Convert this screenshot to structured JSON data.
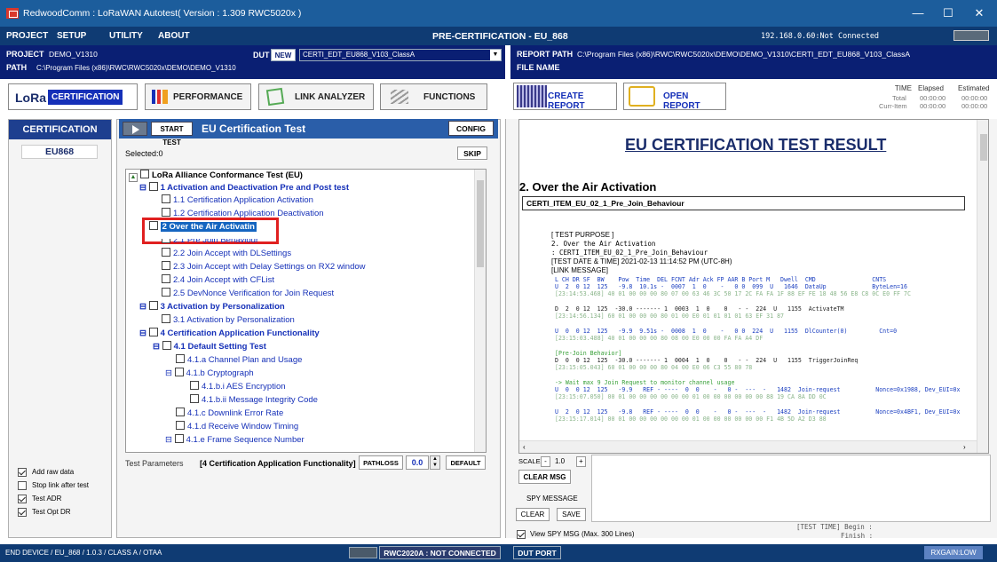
{
  "window": {
    "title": "RedwoodComm : LoRaWAN Autotest( Version : 1.309 RWC5020x )",
    "minimize": "—",
    "maximize": "☐",
    "close": "✕"
  },
  "menu": {
    "items": [
      "PROJECT",
      "SETUP",
      "UTILITY",
      "ABOUT"
    ],
    "center_title": "PRE-CERTIFICATION - EU_868",
    "ip_status": "192.168.0.60:Not Connected"
  },
  "project": {
    "project_label": "PROJECT",
    "project_value": "DEMO_V1310",
    "path_label": "PATH",
    "path_value": "C:\\Program Files (x86)\\RWC\\RWC5020x\\DEMO\\DEMO_V1310",
    "dut_label": "DUT",
    "new_label": "NEW",
    "dut_value": "CERTI_EDT_EU868_V103_ClassA"
  },
  "report": {
    "path_label": "REPORT PATH",
    "path_value": "C:\\Program Files (x86)\\RWC\\RWC5020x\\DEMO\\DEMO_V1310\\CERTI_EDT_EU868_V103_ClassA",
    "file_label": "FILE NAME"
  },
  "toolbar": {
    "lora": "LoRa",
    "certification": "CERTIFICATION",
    "performance": "PERFORMANCE",
    "link_analyzer": "LINK ANALYZER",
    "functions": "FUNCTIONS",
    "create_report": "CREATE REPORT",
    "open_report": "OPEN REPORT"
  },
  "timing": {
    "time": "TIME",
    "elapsed": "Elapsed",
    "estimated": "Estimated",
    "total": "Total",
    "curr_item": "Curr-Item",
    "total_elapsed": "00:00:00",
    "total_estimated": "00:00:00",
    "curr_elapsed": "00:00:00",
    "curr_estimated": "00:00:00"
  },
  "left": {
    "header": "CERTIFICATION",
    "region": "EU868",
    "options": [
      {
        "label": "Add raw data",
        "checked": true
      },
      {
        "label": "Stop link after test",
        "checked": false
      },
      {
        "label": "Test ADR",
        "checked": true
      },
      {
        "label": "Test Opt DR",
        "checked": true
      }
    ]
  },
  "center": {
    "start_test": "START TEST",
    "title": "EU Certification Test",
    "config": "CONFIG",
    "selected": "Selected:0",
    "skip": "SKIP",
    "tree": [
      {
        "label": "LoRa Alliance Conformance Test (EU)",
        "style": "root"
      },
      {
        "label": "1 Activation and Deactivation Pre and Post test",
        "style": "blue"
      },
      {
        "label": "1.1 Certification Application Activation",
        "style": "lnk"
      },
      {
        "label": "1.2 Certification Application Deactivation",
        "style": "lnk"
      },
      {
        "label": "2 Over the Air Activatin",
        "style": "sel"
      },
      {
        "label": "2.1 Pre Join Behaviour",
        "style": "lnk"
      },
      {
        "label": "2.2 Join Accept with DLSettings",
        "style": "lnk"
      },
      {
        "label": "2.3 Join Accept with Delay Settings on RX2 window",
        "style": "lnk"
      },
      {
        "label": "2.4 Join Accept with CFList",
        "style": "lnk"
      },
      {
        "label": "2.5 DevNonce Verification for Join Request",
        "style": "lnk"
      },
      {
        "label": "3 Activation by Personalization",
        "style": "blue"
      },
      {
        "label": "3.1 Activation by Personalization",
        "style": "lnk"
      },
      {
        "label": "4 Certification Application Functionality",
        "style": "blue"
      },
      {
        "label": "4.1 Default Setting Test",
        "style": "blue"
      },
      {
        "label": "4.1.a Channel Plan and Usage",
        "style": "lnk"
      },
      {
        "label": "4.1.b Cryptograph",
        "style": "lnk"
      },
      {
        "label": "4.1.b.i AES Encryption",
        "style": "lnk"
      },
      {
        "label": "4.1.b.ii Message Integrity Code",
        "style": "lnk"
      },
      {
        "label": "4.1.c Downlink Error Rate",
        "style": "lnk"
      },
      {
        "label": "4.1.d Receive Window Timing",
        "style": "lnk"
      },
      {
        "label": "4.1.e Frame Sequence Number",
        "style": "lnk"
      }
    ],
    "test_params_label": "Test Parameters",
    "test_params_value": "[4 Certification Application Functionality]",
    "pathloss": "PATHLOSS",
    "pathloss_value": "0.0",
    "default": "DEFAULT"
  },
  "right": {
    "heading": "EU CERTIFICATION TEST RESULT",
    "section": "2. Over the Air Activation",
    "item": "CERTI_ITEM_EU_02_1_Pre_Join_Behaviour",
    "purpose_lines": [
      "[ TEST PURPOSE ]",
      "2. Over the Air Activation",
      " : CERTI_ITEM_EU_02_1_Pre_Join_Behaviour",
      "[TEST DATE & TIME] 2021-02-13 11:14:52 PM (UTC-8H)",
      "[LINK MESSAGE]"
    ],
    "log_header": " L CH DR SF  BW    Pow  Time  DEL FCNT Adr Ack FP AAR B Port M   Dwell  CMD                CNTS",
    "log_rows": [
      {
        "main": " U  2  0 12  125   -9.8  10.1s -  0007  1  0    -   0 0  099  U   1646  DataUp             ByteLen=16",
        "raw": " [23:14:53.468] 40 01 00 00 00 80 07 00 63 46 3C 50 17 2C FA FA 1F 88 EF FE 18 48 56 E8 C8 0C E0 FF 7C",
        "cls": "b"
      },
      {
        "main": " D  2  0 12  125  -30.0 ------- 1  0003  1  0    0   - -  224  U   1155  ActivateTM",
        "raw": " [23:14:56.134] 60 01 00 00 00 80 01 00 E0 01 01 01 01 63 EF 31 87",
        "cls": "k"
      },
      {
        "main": " U  0  0 12  125   -9.9  9.51s -  0008  1  0    -   0 0  224  U   1155  DlCounter(0)         Cnt=0",
        "raw": " [23:15:03.488] 40 01 00 00 00 80 08 00 E0 00 00 FA FA A4 DF",
        "cls": "b"
      },
      {
        "main": " [Pre-Join Behavior]",
        "raw": "",
        "cls": "g"
      },
      {
        "main": " D  0  0 12  125  -30.0 ------- 1  0004  1  0    0   - -  224  U   1155  TriggerJoinReq",
        "raw": " [23:15:05.043] 60 01 00 00 00 80 04 00 E0 06 C3 55 80 78",
        "cls": "k"
      },
      {
        "main": " -> Wait max 9 Join Request to monitor channel usage",
        "raw": "",
        "cls": "g"
      },
      {
        "main": " U  0  0 12  125   -9.9   REF - ----  0  0    -   0 -  ---  -   1482  Join-request          Nonce=0x1988, Dev_EUI=0x",
        "raw": " [23:15:07.050] 00 01 00 00 00 00 00 00 01 00 00 00 00 00 00 88 19 CA 8A DD 0C",
        "cls": "b"
      },
      {
        "main": " U  2  0 12  125   -9.8   REF - ----  0  0    -   0 -  ---  -   1482  Join-request          Nonce=0x4BF1, Dev_EUI=0x",
        "raw": " [23:15:17.014] 00 01 00 00 00 00 00 00 01 00 00 00 00 00 00 F1 4B 5D A2 D3 88",
        "cls": "b"
      }
    ]
  },
  "spy": {
    "scale_label": "SCALE",
    "minus": "-",
    "scale_value": "1.0",
    "plus": "+",
    "clear_msg": "CLEAR MSG",
    "spy_message": "SPY MESSAGE",
    "clear": "CLEAR",
    "save": "SAVE",
    "view_spy": "View SPY MSG (Max. 300 Lines)",
    "test_time": "[TEST TIME] Begin  :",
    "finish": "Finish :"
  },
  "status": {
    "device": "END DEVICE / EU_868 / 1.0.3 / CLASS A / OTAA",
    "rwc": "RWC2020A : NOT CONNECTED",
    "dut_port": "DUT PORT",
    "rxgain": "RXGAIN:LOW"
  },
  "colors": {
    "titlebar": "#1c5d9c",
    "menubar": "#0f3b73",
    "infobar": "#0a1f73",
    "accent": "#2a5ea9",
    "highlight_box": "#e02020",
    "selection": "#1565c0"
  }
}
